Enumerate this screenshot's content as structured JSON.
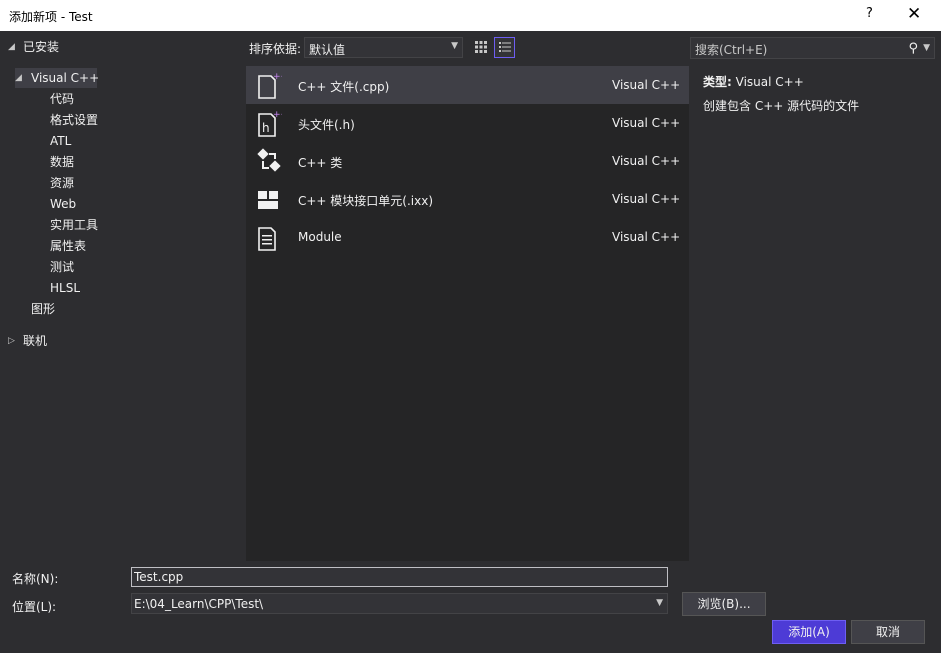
{
  "window": {
    "title": "添加新项 - Test",
    "help": "?",
    "close": "✕"
  },
  "tree": {
    "installed": "已安装",
    "visual_cpp": "Visual C++",
    "children": [
      "代码",
      "格式设置",
      "ATL",
      "数据",
      "资源",
      "Web",
      "实用工具",
      "属性表",
      "测试",
      "HLSL"
    ],
    "graphics": "图形",
    "online": "联机"
  },
  "sort": {
    "label": "排序依据:",
    "value": "默认值"
  },
  "search": {
    "placeholder": "搜索(Ctrl+E)"
  },
  "templates": [
    {
      "name": "C++ 文件(.cpp)",
      "lang": "Visual C++",
      "icon": "cpp-file-icon"
    },
    {
      "name": "头文件(.h)",
      "lang": "Visual C++",
      "icon": "header-file-icon"
    },
    {
      "name": "C++ 类",
      "lang": "Visual C++",
      "icon": "class-icon"
    },
    {
      "name": "C++ 模块接口单元(.ixx)",
      "lang": "Visual C++",
      "icon": "module-interface-icon"
    },
    {
      "name": "Module",
      "lang": "Visual C++",
      "icon": "module-file-icon"
    }
  ],
  "details": {
    "type_label": "类型:",
    "type_value": "Visual C++",
    "description": "创建包含 C++ 源代码的文件"
  },
  "form": {
    "name_label": "名称(N):",
    "name_value": "Test.cpp",
    "location_label": "位置(L):",
    "location_value": "E:\\04_Learn\\CPP\\Test\\"
  },
  "buttons": {
    "browse": "浏览(B)...",
    "add": "添加(A)",
    "cancel": "取消"
  },
  "colors": {
    "background": "#2d2d30",
    "list_bg": "#252526",
    "selection": "#3f3f46",
    "accent": "#6e5ef2"
  }
}
